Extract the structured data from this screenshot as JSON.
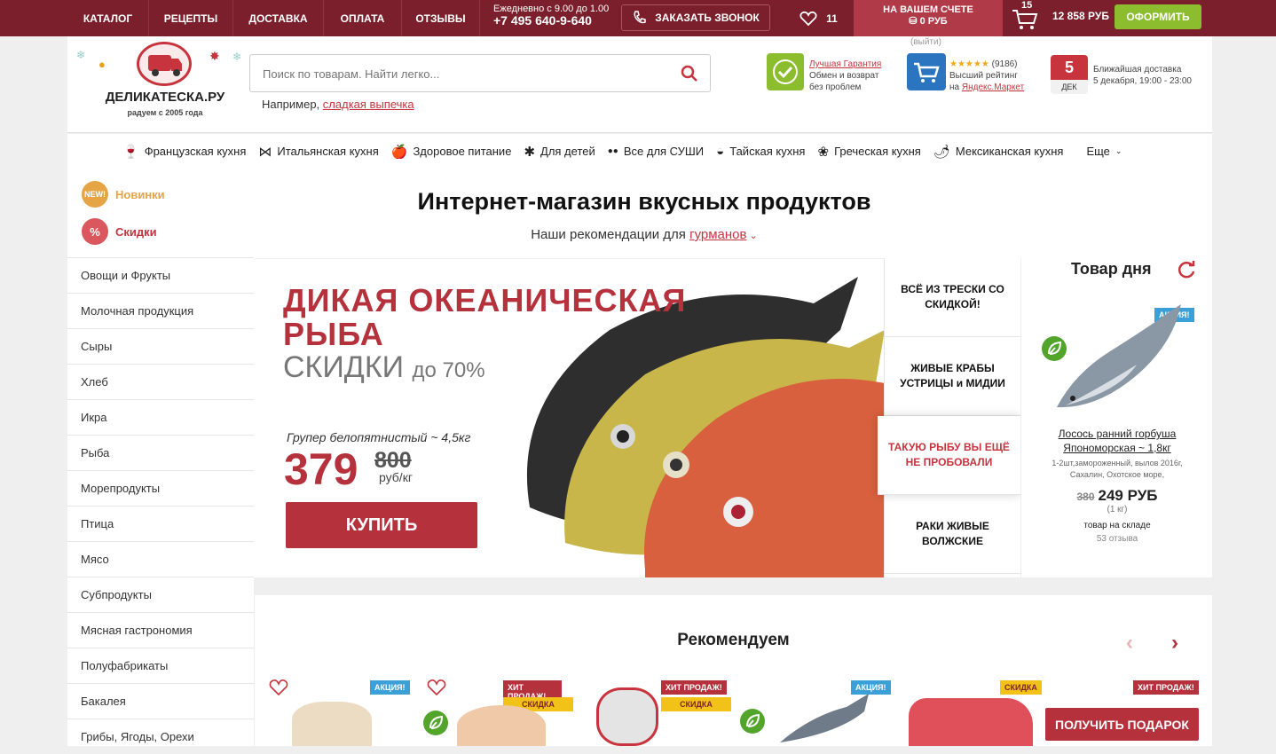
{
  "topbar": {
    "nav": [
      "КАТАЛОГ",
      "РЕЦЕПТЫ",
      "ДОСТАВКА",
      "ОПЛАТА",
      "ОТЗЫВЫ"
    ],
    "hours": "Ежедневно с 9.00 до 1.00",
    "phone": "+7 495 640-9-640",
    "call_label": "ЗАКАЗАТЬ ЗВОНОК",
    "favorites_count": "11",
    "account_label": "НА ВАШЕМ СЧЕТЕ",
    "account_value": "0 РУБ",
    "logout": "(выйти)",
    "cart_count": "15",
    "cart_sum": "12 858 РУБ",
    "checkout_label": "ОФОРМИТЬ"
  },
  "header": {
    "logo_name": "ДЕЛИКАТЕСКА.РУ",
    "logo_tagline": "радуем с 2005 года",
    "search_placeholder": "Поиск по товарам. Найти легко...",
    "example_prefix": "Например,",
    "example_link": "сладкая выпечка",
    "guarantee_link": "Лучшая Гарантия",
    "guarantee_l2": "Обмен и возврат",
    "guarantee_l3": "без проблем",
    "rating_stars": "★★★★★",
    "rating_count": "(9186)",
    "rating_l2": "Высший рейтинг",
    "rating_prefix": "на",
    "rating_link": "Яндекс.Маркет",
    "delivery_day": "5",
    "delivery_month": "ДЕК",
    "delivery_l1": "Ближайшая доставка",
    "delivery_l2": "5 декабря, 19:00 - 23:00"
  },
  "categories": [
    {
      "label": "Французская кухня",
      "icon": "🍷"
    },
    {
      "label": "Итальянская кухня",
      "icon": "⋈"
    },
    {
      "label": "Здоровое питание",
      "icon": "🍎"
    },
    {
      "label": "Для детей",
      "icon": "✱"
    },
    {
      "label": "Все для СУШИ",
      "icon": "●●"
    },
    {
      "label": "Тайская кухня",
      "icon": "◒"
    },
    {
      "label": "Греческая кухня",
      "icon": "❀"
    },
    {
      "label": "Мексиканская кухня",
      "icon": "🌶"
    }
  ],
  "categories_more": "Еще",
  "sidebar": {
    "new_label": "Новинки",
    "new_badge": "NEW!",
    "sale_label": "Скидки",
    "sale_badge": "%",
    "items": [
      "Овощи и Фрукты",
      "Молочная продукция",
      "Сыры",
      "Хлеб",
      "Икра",
      "Рыба",
      "Морепродукты",
      "Птица",
      "Мясо",
      "Субпродукты",
      "Мясная гастрономия",
      "Полуфабрикаты",
      "Бакалея",
      "Грибы, Ягоды, Орехи"
    ]
  },
  "hero": {
    "title": "Интернет-магазин вкусных продуктов",
    "subtitle": "Наши рекомендации для",
    "subtitle_link": "гурманов"
  },
  "banner": {
    "line1": "ДИКАЯ ОКЕАНИЧЕСКАЯ",
    "line2": "РЫБА",
    "sale_word": "СКИДКИ",
    "sale_upto": "до 70%",
    "product": "Групер белопятнистый ~ 4,5кг",
    "price": "379",
    "old_price": "800",
    "unit": "руб/кг",
    "buy_label": "КУПИТЬ"
  },
  "promos": [
    "ВСЁ ИЗ ТРЕСКИ СО СКИДКОЙ!",
    "ЖИВЫЕ КРАБЫ УСТРИЦЫ и МИДИИ",
    "ТАКУЮ РЫБУ ВЫ ЕЩЁ НЕ ПРОБОВАЛИ",
    "РАКИ ЖИВЫЕ ВОЛЖСКИЕ"
  ],
  "day_product": {
    "title": "Товар дня",
    "badge": "АКЦИЯ!",
    "name": "Лосось ранний горбуша Япономорская ~ 1,8кг",
    "desc": "1-2шт,замороженный, вылов 2016г, Сахалин, Охотское море,",
    "old_price": "380",
    "price": "249 РУБ",
    "unit": "(1 кг)",
    "stock": "товар на складе",
    "reviews": "53 отзыва"
  },
  "recommend": {
    "title": "Рекомендуем",
    "prev": "‹",
    "next": "›",
    "badge_akcia": "АКЦИЯ!",
    "badge_hit": "ХИТ ПРОДАЖ!",
    "badge_skidka": "СКИДКА"
  },
  "gift_button": "ПОЛУЧИТЬ ПОДАРОК",
  "colors": {
    "brand": "#7a1f2b",
    "accent": "#b5313c",
    "green": "#8bbd2f",
    "blue": "#2a74c0"
  }
}
